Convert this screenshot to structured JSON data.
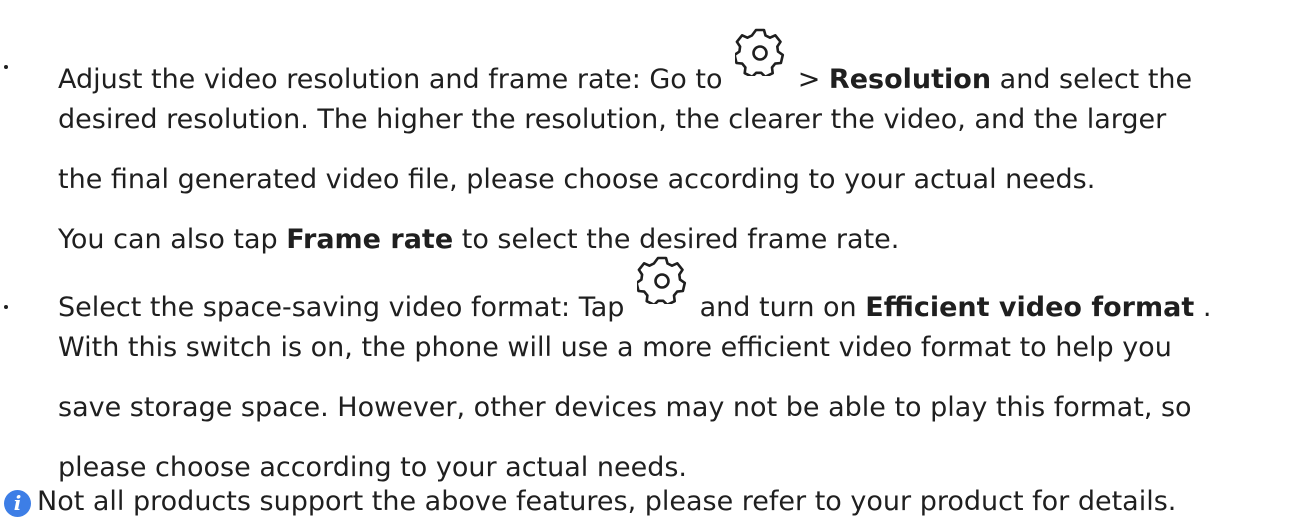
{
  "bullets": [
    {
      "lines": [
        {
          "pre": "Adjust the video resolution and frame rate: Go to",
          "gear_icon": "gear-icon",
          "mid": " > ",
          "bold": "Resolution",
          "post": " and select the"
        },
        {
          "text": "desired resolution. The higher the resolution, the clearer the video, and the larger"
        },
        {
          "text": "the final generated video file, please choose according to your actual needs."
        },
        {
          "pre": "You can also tap ",
          "bold": "Frame rate",
          "post": " to select the desired frame rate."
        }
      ]
    },
    {
      "lines": [
        {
          "pre": "Select the space-saving video format: Tap",
          "gear_icon": "gear-icon",
          "mid": " and turn on ",
          "bold": "Efficient video format",
          "post": "."
        },
        {
          "text": "With this switch is on, the phone will use a more efficient video format to help you"
        },
        {
          "text": "save storage space. However, other devices may not be able to play this format, so"
        },
        {
          "text": "please choose according to your actual needs."
        }
      ]
    }
  ],
  "note": {
    "icon": "info-icon",
    "icon_glyph": "i",
    "text": "Not all products support the above features, please refer to your product for details."
  },
  "colors": {
    "text": "#1f1f1f",
    "info_icon": "#3d7ee6"
  }
}
